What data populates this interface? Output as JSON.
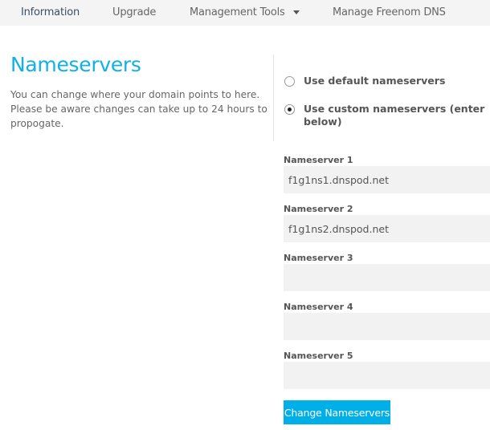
{
  "nav": {
    "items": [
      {
        "label": "Information",
        "active": true
      },
      {
        "label": "Upgrade"
      },
      {
        "label": "Management Tools",
        "has_dropdown": true
      },
      {
        "label": "Manage Freenom DNS"
      }
    ]
  },
  "section": {
    "title": "Nameservers",
    "description": "You can change where your domain points to here. Please be aware changes can take up to 24 hours to propogate."
  },
  "options": {
    "default_label": "Use default nameservers",
    "custom_label": "Use custom nameservers (enter below)",
    "selected": "custom"
  },
  "nameservers": [
    {
      "label": "Nameserver 1",
      "value": "f1g1ns1.dnspod.net"
    },
    {
      "label": "Nameserver 2",
      "value": "f1g1ns2.dnspod.net"
    },
    {
      "label": "Nameserver 3",
      "value": ""
    },
    {
      "label": "Nameserver 4",
      "value": ""
    },
    {
      "label": "Nameserver 5",
      "value": ""
    }
  ],
  "submit_label": "Change Nameservers",
  "colors": {
    "accent": "#00aee8",
    "title": "#10b0e8",
    "nav_bg": "#f4f4f4",
    "field_bg": "#f2f2f2"
  }
}
